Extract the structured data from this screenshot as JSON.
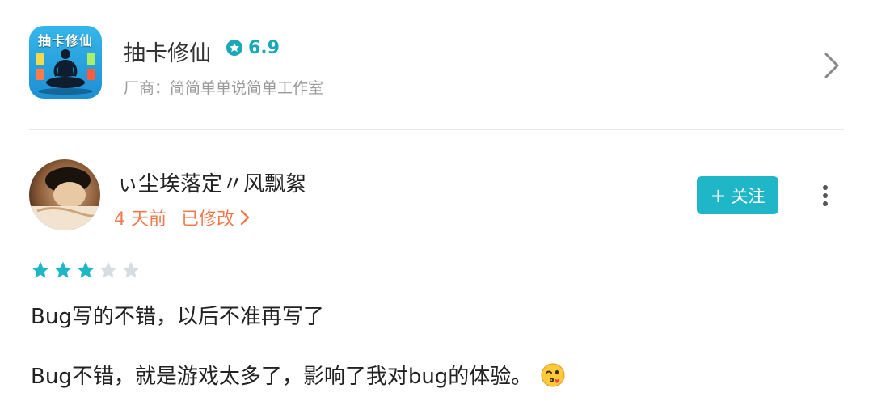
{
  "app": {
    "icon_title": "抽卡修仙",
    "name": "抽卡修仙",
    "rating": "6.9",
    "developer_line": "厂商：简简单单说简单工作室",
    "accent_color": "#18a9b9"
  },
  "review": {
    "username": "ぃ尘埃落定〃风飘絮",
    "time": "4 天前",
    "edited": "已修改",
    "follow_label": "关注",
    "follow_plus": "+",
    "stars": {
      "filled": 3,
      "total": 5
    },
    "line1": "Bug写的不错，以后不准再写了",
    "line2": "Bug不错，就是游戏太多了，影响了我对bug的体验。",
    "emoji": "wink-kiss-emoji",
    "meta_color": "#f07a4e",
    "button_color": "#1fb7c7"
  }
}
